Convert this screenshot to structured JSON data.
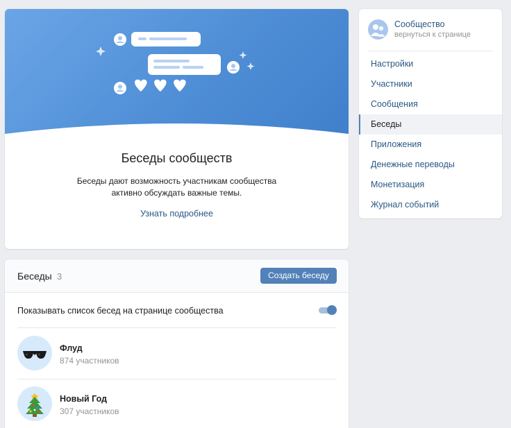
{
  "intro": {
    "title": "Беседы сообществ",
    "description": "Беседы дают возможность участникам сообщества активно обсуждать важные темы.",
    "learn_more": "Узнать подробнее"
  },
  "chats": {
    "title": "Беседы",
    "count": "3",
    "create_button": "Создать беседу",
    "show_list_label": "Показывать список бесед на странице сообщества",
    "show_list_enabled": true,
    "items": [
      {
        "name": "Флуд",
        "members": "874 участников",
        "avatar_icon": "sunglasses-icon"
      },
      {
        "name": "Новый Год",
        "members": "307 участников",
        "avatar_icon": "christmas-tree-icon"
      }
    ]
  },
  "sidebar": {
    "community_name": "Сообщество",
    "back_label": "вернуться к странице",
    "items": [
      {
        "label": "Настройки"
      },
      {
        "label": "Участники"
      },
      {
        "label": "Сообщения"
      },
      {
        "label": "Беседы",
        "active": true
      },
      {
        "label": "Приложения"
      },
      {
        "label": "Денежные переводы"
      },
      {
        "label": "Монетизация"
      },
      {
        "label": "Журнал событий"
      }
    ]
  },
  "colors": {
    "accent": "#5181b8",
    "link": "#2a5885",
    "page_background": "#ebedf0",
    "hero_gradient": "#4f8ed6"
  }
}
